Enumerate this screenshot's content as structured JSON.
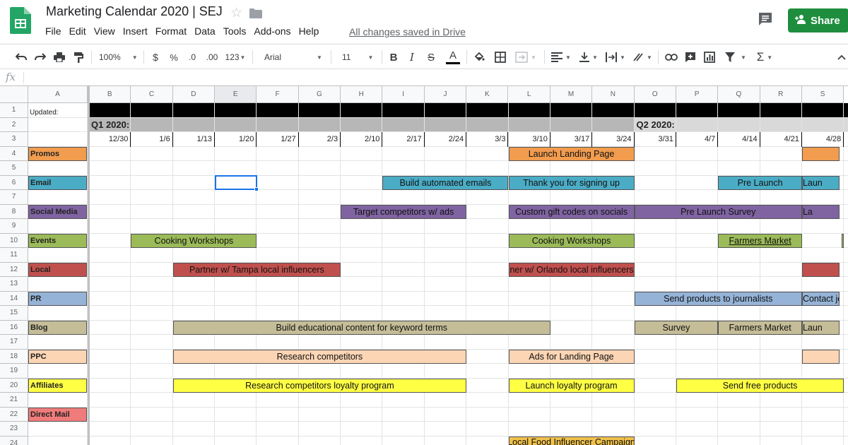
{
  "app": {
    "doc_title": "Marketing Calendar 2020 | SEJ",
    "saved_status": "All changes saved in Drive",
    "share_label": "Share",
    "menu": [
      "File",
      "Edit",
      "View",
      "Insert",
      "Format",
      "Data",
      "Tools",
      "Add-ons",
      "Help"
    ]
  },
  "toolbar": {
    "zoom": "100%",
    "currency": "$",
    "percent": "%",
    "decrease_decimals": ".0",
    "increase_decimals": ".00",
    "more_formats": "123",
    "font": "Arial",
    "font_size": "11"
  },
  "formula_bar": {
    "fx_label": "fx",
    "value": ""
  },
  "sheet": {
    "columns": [
      "A",
      "B",
      "C",
      "D",
      "E",
      "F",
      "G",
      "H",
      "I",
      "J",
      "K",
      "L",
      "M",
      "N",
      "O",
      "P",
      "Q",
      "R",
      "S"
    ],
    "rows": [
      "1",
      "2",
      "3",
      "4",
      "5",
      "6",
      "7",
      "8",
      "9",
      "10",
      "11",
      "12",
      "13",
      "14",
      "15",
      "16",
      "17",
      "18",
      "19",
      "20",
      "21",
      "22",
      "23",
      "24"
    ],
    "selected_column": "E",
    "selected_cell": "E6",
    "updated_label": "Updated:",
    "quarters": [
      "Q1 2020:",
      "Q2 2020:"
    ],
    "dates": [
      "12/30",
      "1/6",
      "1/13",
      "1/20",
      "1/27",
      "2/3",
      "2/10",
      "2/17",
      "2/24",
      "3/3",
      "3/10",
      "3/17",
      "3/24",
      "3/31",
      "4/7",
      "4/14",
      "4/21",
      "4/28"
    ],
    "categories": [
      {
        "label": "Promos",
        "color": "#f19c4f"
      },
      {
        "label": "Email",
        "color": "#4bacc6"
      },
      {
        "label": "Social Media",
        "color": "#8064a2"
      },
      {
        "label": "Events",
        "color": "#9bbb59"
      },
      {
        "label": "Local",
        "color": "#c0504d"
      },
      {
        "label": "PR",
        "color": "#95b3d7"
      },
      {
        "label": "Blog",
        "color": "#c4bd97"
      },
      {
        "label": "PPC",
        "color": "#fcd5b4"
      },
      {
        "label": "Affiliates",
        "color": "#ffff44"
      },
      {
        "label": "Direct Mail",
        "color": "#f07b7b"
      }
    ],
    "tasks": {
      "promos_1": "Launch Landing Page",
      "email_1": "Build automated emails",
      "email_2": "Thank you for signing up",
      "email_3": "Pre Launch",
      "email_4": "Laun",
      "social_1": "Target competitors w/ ads",
      "social_2": "Custom gift codes on socials",
      "social_3": "Pre Launch Survey",
      "social_4": "La",
      "events_1": "Cooking Workshops",
      "events_2": "Cooking Workshops",
      "events_3": "Farmers Market",
      "local_1": "Partner w/ Tampa local influencers",
      "local_2": "Partner w/ Orlando local influencers",
      "pr_1": "Send products to journalists",
      "pr_2": "Contact jo",
      "blog_1": "Build educational content for keyword terms",
      "blog_2": "Survey",
      "blog_3": "Farmers Market",
      "blog_4": "Laun",
      "ppc_1": "Research competitors",
      "ppc_2": "Ads for Landing Page",
      "aff_1": "Research competitors loyalty program",
      "aff_2": "Launch loyalty program",
      "aff_3": "Send free products",
      "row24_1": "Local Food Influencer Campaign"
    }
  }
}
